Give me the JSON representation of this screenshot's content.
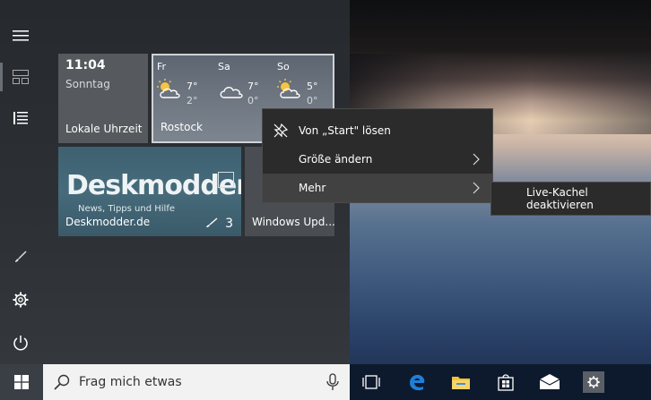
{
  "start_menu": {
    "tiles": {
      "clock": {
        "time": "11:04",
        "day": "Sonntag",
        "label": "Lokale Uhrzeit"
      },
      "weather": {
        "label": "Rostock",
        "days": [
          {
            "day": "Fr",
            "high": "7°",
            "low": "2°"
          },
          {
            "day": "Sa",
            "high": "7°",
            "low": "0°"
          },
          {
            "day": "So",
            "high": "5°",
            "low": "0°"
          }
        ]
      },
      "deskmodder": {
        "brand": "Deskmodder.de",
        "slogan": "News, Tipps und Hilfe",
        "label": "Deskmodder.de",
        "count": "3"
      },
      "windows_update": {
        "label": "Windows Upd..."
      }
    }
  },
  "context_menu": {
    "items": [
      {
        "label": "Von „Start\" lösen"
      },
      {
        "label": "Größe ändern"
      },
      {
        "label": "Mehr"
      }
    ],
    "submenu": {
      "label": "Live-Kachel deaktivieren"
    }
  },
  "taskbar": {
    "search_placeholder": "Frag mich etwas"
  },
  "colors": {
    "start_bg": "#2d3135",
    "clock_tile": "#56595d",
    "menu_bg": "#2b2b2b",
    "menu_highlight": "#414141",
    "taskbar_bg": "#0d1a2d",
    "edge_blue": "#1e7fd9",
    "explorer_yellow": "#f3c13a"
  }
}
